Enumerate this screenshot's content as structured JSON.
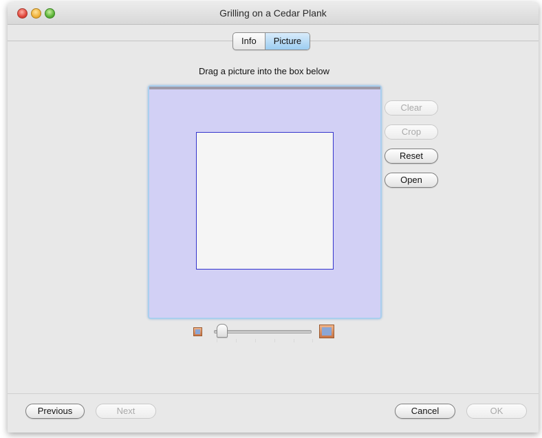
{
  "window": {
    "title": "Grilling on a Cedar Plank"
  },
  "tabs": [
    {
      "label": "Info",
      "selected": false
    },
    {
      "label": "Picture",
      "selected": true
    }
  ],
  "picture_panel": {
    "instructions": "Drag a picture into the box below",
    "buttons": {
      "clear": {
        "label": "Clear",
        "enabled": false
      },
      "crop": {
        "label": "Crop",
        "enabled": false
      },
      "reset": {
        "label": "Reset",
        "enabled": true
      },
      "open": {
        "label": "Open",
        "enabled": true
      }
    },
    "zoom_slider": {
      "min_icon": "small-picture-icon",
      "max_icon": "large-picture-icon"
    }
  },
  "footer": {
    "previous": {
      "label": "Previous",
      "enabled": true
    },
    "next": {
      "label": "Next",
      "enabled": false
    },
    "cancel": {
      "label": "Cancel",
      "enabled": true
    },
    "ok": {
      "label": "OK",
      "enabled": false
    }
  },
  "colors": {
    "well_background": "#d2d0f5",
    "crop_frame_border": "#3333cc",
    "selected_tab": "#9ccdf1"
  }
}
